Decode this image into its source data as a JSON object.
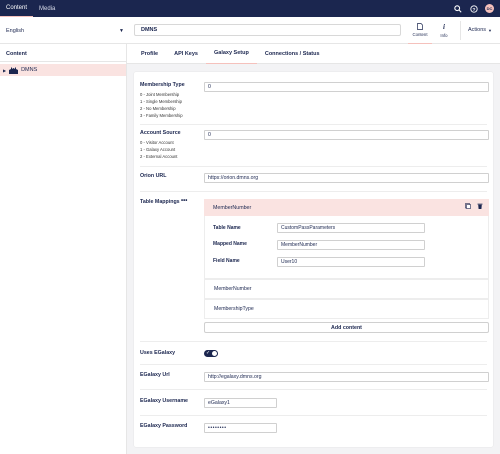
{
  "topbar": {
    "tabs": [
      {
        "label": "Content",
        "active": true
      },
      {
        "label": "Media",
        "active": false
      }
    ],
    "icons": [
      "search-icon",
      "help-icon"
    ],
    "avatar_initials": "DC"
  },
  "header": {
    "language": "English",
    "node_name": "DMNS",
    "apps": [
      {
        "label": "Content",
        "icon": "document-icon",
        "active": true
      },
      {
        "label": "Info",
        "icon": "info-icon",
        "active": false
      }
    ],
    "actions_label": "Actions"
  },
  "sidebar": {
    "title": "Content",
    "tree": [
      {
        "label": "DMNS"
      }
    ]
  },
  "tabs": [
    {
      "label": "Profile",
      "active": false
    },
    {
      "label": "API Keys",
      "active": false
    },
    {
      "label": "Galaxy Setup",
      "active": true
    },
    {
      "label": "Connections / Status",
      "active": false
    }
  ],
  "form": {
    "membership_type": {
      "label": "Membership Type",
      "value": "0",
      "options": [
        "0 - Joint Membership",
        "1 - Single Membership",
        "2 - No Membership",
        "3 - Family Membership"
      ]
    },
    "account_source": {
      "label": "Account Source",
      "value": "0",
      "options": [
        "0 - Visitor Account",
        "1 - Galaxy Account",
        "2 - External Account"
      ]
    },
    "orion_url": {
      "label": "Orion URL",
      "value": "https://orion.dmns.org"
    },
    "table_mappings": {
      "label": "Table Mappings",
      "more": "•••",
      "expanded_item": {
        "title": "MemberNumber",
        "table_name_label": "Table Name",
        "table_name": "CustomPassParameters",
        "mapped_name_label": "Mapped Name",
        "mapped_name": "MemberNumber",
        "field_name_label": "Field Name",
        "field_name": "User10"
      },
      "items": [
        "MemberNumber",
        "MembershipType"
      ],
      "add_label": "Add content"
    },
    "uses_egalaxy": {
      "label": "Uses EGalaxy",
      "on": true
    },
    "egalaxy_url": {
      "label": "EGalaxy Url",
      "value": "http://egalaxy.dmns.org"
    },
    "egalaxy_username": {
      "label": "EGalaxy Username",
      "value": "eGalaxy1"
    },
    "egalaxy_password": {
      "label": "EGalaxy Password",
      "value": "••••••••"
    }
  },
  "colors": {
    "navy": "#1b264f",
    "accent_pink": "#f5c1bc",
    "selected_bg": "#fae3e1"
  }
}
